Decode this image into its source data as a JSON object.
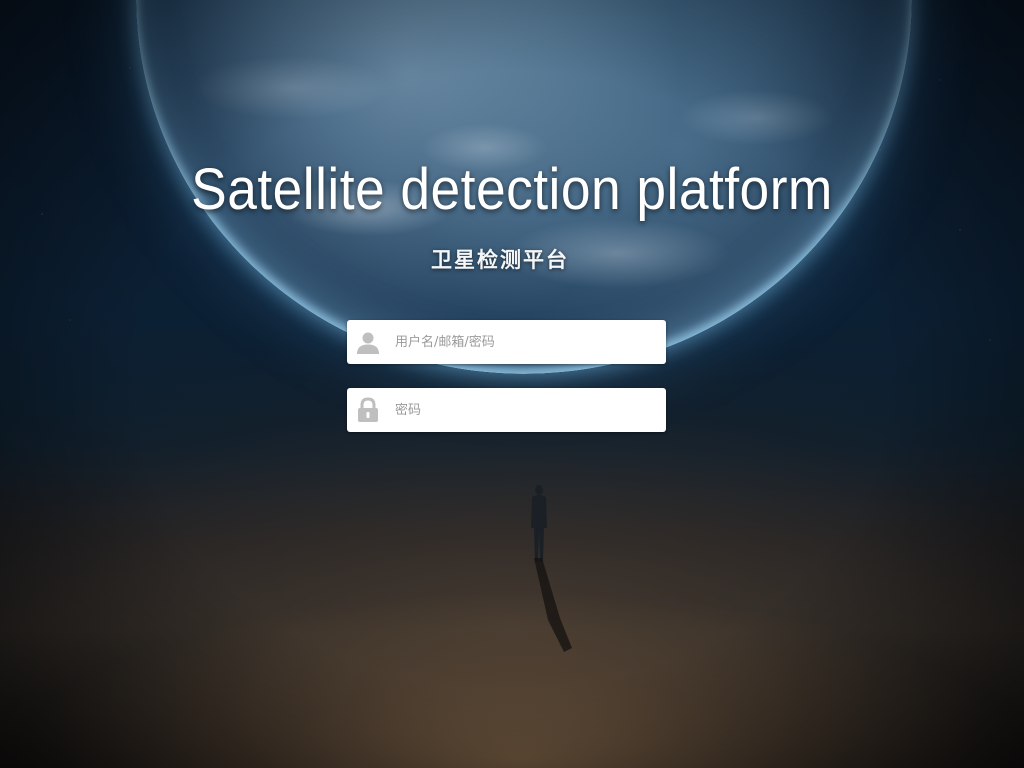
{
  "page": {
    "title": "Satellite detection platform",
    "subtitle": "卫星检测平台"
  },
  "login_form": {
    "username": {
      "placeholder": "用户名/邮箱/密码",
      "value": "",
      "icon": "user-icon"
    },
    "password": {
      "placeholder": "密码",
      "value": "",
      "icon": "lock-icon"
    }
  },
  "colors": {
    "sky": "#0c2034",
    "planet_glow": "#78bee8",
    "ground": "#5a4838",
    "field_background": "#ffffff",
    "icon_gray": "#bfbfbf"
  }
}
